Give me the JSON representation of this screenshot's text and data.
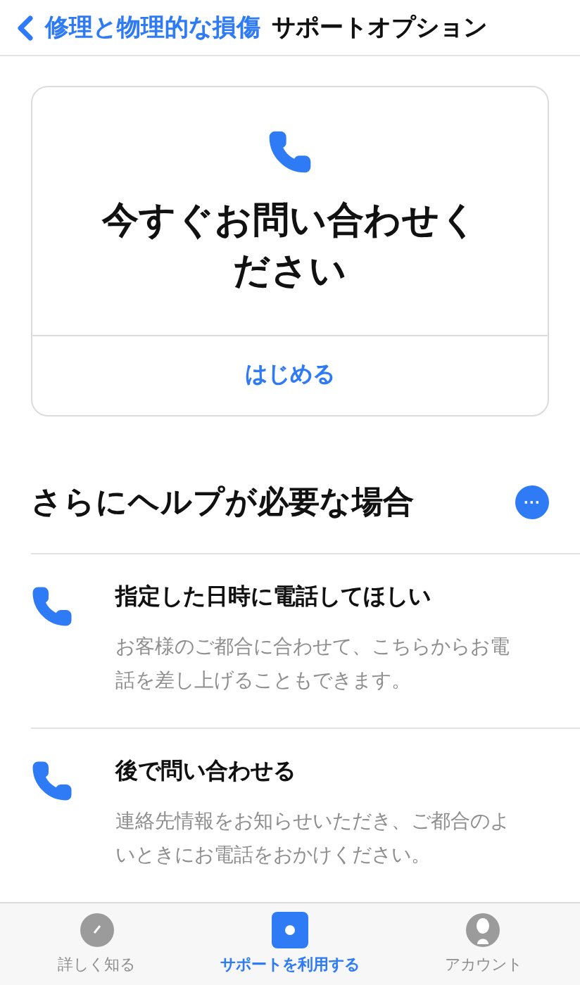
{
  "nav": {
    "back": "修理と物理的な損傷",
    "title": "サポートオプション"
  },
  "card": {
    "title": "今すぐお問い合わせください",
    "action": "はじめる"
  },
  "section": {
    "heading": "さらにヘルプが必要な場合",
    "more": "···"
  },
  "options": [
    {
      "title": "指定した日時に電話してほしい",
      "description": "お客様のご都合に合わせて、こちらからお電話を差し上げることもできます。"
    },
    {
      "title": "後で問い合わせる",
      "description": "連絡先情報をお知らせいただき、ご都合のよいときにお電話をおかけください。"
    }
  ],
  "tabs": [
    {
      "label": "詳しく知る",
      "kind": "explore",
      "selected": false
    },
    {
      "label": "サポートを利用する",
      "kind": "support",
      "selected": true
    },
    {
      "label": "アカウント",
      "kind": "account",
      "selected": false
    }
  ]
}
